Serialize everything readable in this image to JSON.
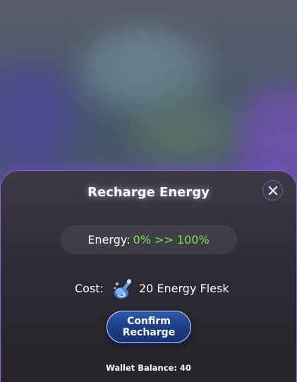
{
  "dialog": {
    "title": "Recharge Energy",
    "close_icon": "close-icon"
  },
  "energy": {
    "label": "Energy:",
    "value": "0% >> 100%"
  },
  "cost": {
    "label": "Cost:",
    "icon": "energy-flask-icon",
    "amount": "20 Energy Flesk"
  },
  "confirm_button": {
    "line1": "Confirm",
    "line2": "Recharge"
  },
  "wallet": {
    "label": "Wallet Balance: 40"
  },
  "colors": {
    "accent_border": "#8a66d6",
    "energy_value": "#7fe25a",
    "button_blue": "#1c3d86"
  }
}
